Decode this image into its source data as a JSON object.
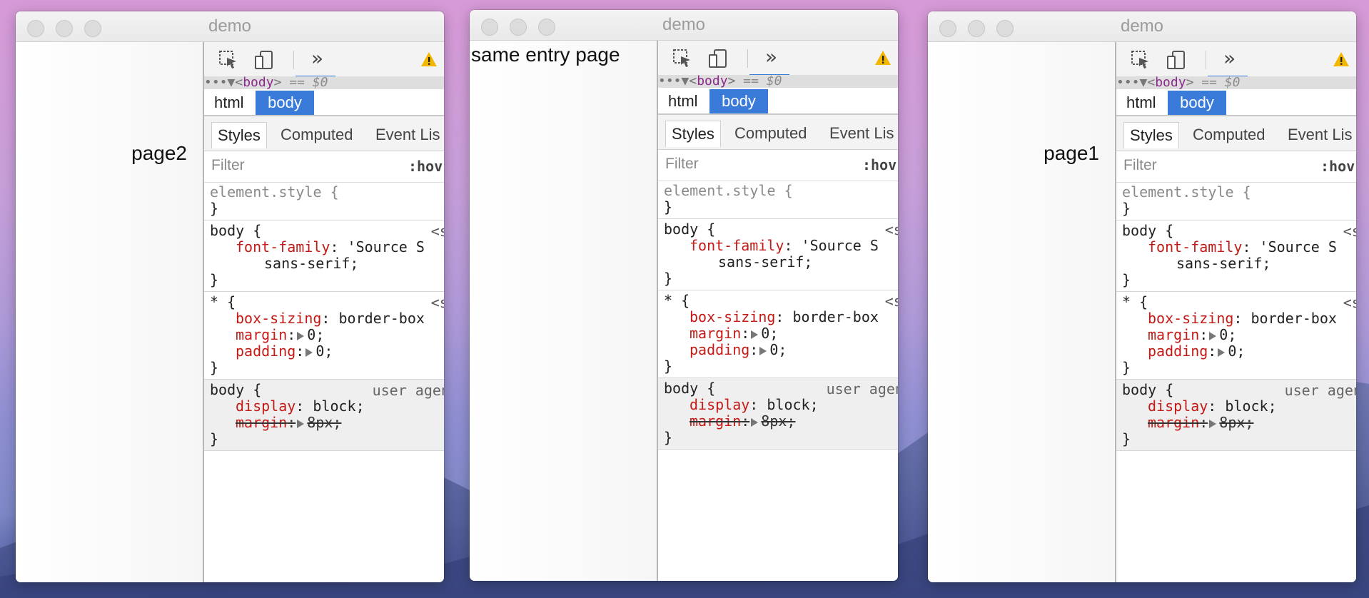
{
  "windows": [
    {
      "title": "demo",
      "page_label": "page2",
      "label_pos": "right"
    },
    {
      "title": "demo",
      "page_label": "same entry page",
      "label_pos": "top-left"
    },
    {
      "title": "demo",
      "page_label": "page1",
      "label_pos": "right"
    }
  ],
  "devtools": {
    "toolbar": {
      "more_tools_label": "»"
    },
    "crumb": {
      "dots": "•••▼",
      "tag_open": "<",
      "tag": "body",
      "tag_close": ">",
      "eq": " == $0"
    },
    "breadcrumbs": {
      "html": "html",
      "body": "body"
    },
    "tabs": {
      "styles": "Styles",
      "computed": "Computed",
      "event_listeners": "Event Lis"
    },
    "filter": {
      "placeholder": "Filter",
      "hov": ":hov"
    },
    "rules": {
      "element_style": {
        "selector": "element.style {",
        "close": "}"
      },
      "body_font": {
        "selector": "body {",
        "source": "<style",
        "prop": "font-family",
        "value": ": 'Source S",
        "value2": "sans-serif;",
        "close": "}"
      },
      "universal": {
        "selector": "* {",
        "source": "<style",
        "p1": "box-sizing",
        "v1": ": border-box",
        "p2": "margin",
        "v2": "0;",
        "p3": "padding",
        "v3": "0;",
        "close": "}"
      },
      "body_ua": {
        "selector": "body {",
        "source": "user agent",
        "p1": "display",
        "v1": ": block;",
        "p2": "margin",
        "v2": "8px;",
        "close": "}"
      }
    }
  },
  "colors": {
    "accent_blue": "#3a7ad9",
    "prop_red": "#c41a16",
    "tag_purple": "#8b2a8b",
    "warning_yellow": "#f3b700"
  },
  "icons": [
    "inspect-element-icon",
    "device-toolbar-icon",
    "more-tools-icon",
    "warning-icon"
  ]
}
